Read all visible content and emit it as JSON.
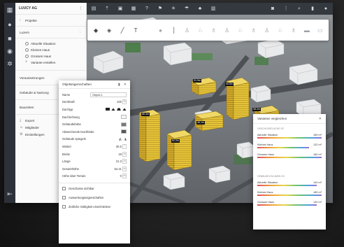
{
  "app": {
    "project_name": "LUUCY AG"
  },
  "left_panel": {
    "projects_label": "Projekte",
    "current_project": "Luzern",
    "variants": [
      "Aktuelle Situation",
      "Kleines Haus",
      "Grosses Haus"
    ],
    "add_variant": "Variante erstellen",
    "sections": [
      "Voraussetzungen",
      "Gebäude & Nutzung",
      "Bauzeiten"
    ],
    "actions": [
      "Export",
      "Mitglieder",
      "Einstellungen"
    ]
  },
  "properties_panel": {
    "title": "Objekteigenschaften",
    "name_label": "Name",
    "name_value": "Objekt 1",
    "fields": [
      {
        "label": "Deckkraft",
        "value": "100",
        "unit": "%"
      },
      {
        "label": "Dachtyp",
        "value": ""
      },
      {
        "label": "Dachrichtung",
        "value": ""
      },
      {
        "label": "Gebäudefarbe",
        "value": ""
      },
      {
        "label": "Abweichende Dachfarbe",
        "value": ""
      },
      {
        "label": "Gebäude spiegeln",
        "value": ""
      },
      {
        "label": "Winkel",
        "value": "30.5",
        "unit": "°"
      },
      {
        "label": "Breite",
        "value": "19",
        "unit": "m"
      },
      {
        "label": "Länge",
        "value": "21.3",
        "unit": "m"
      },
      {
        "label": "Gesamthöhe",
        "value": "52.21",
        "unit": "m"
      },
      {
        "label": "Höhe über Terrain",
        "value": "0",
        "unit": "m"
      }
    ],
    "checkboxes": [
      "Geschosse sichtbar",
      "Auswertungseigenschaften",
      "Zeitliche Gültigkeit einschränken"
    ]
  },
  "variants_panel": {
    "title": "Varianten vergleichen",
    "sections": [
      {
        "label": "GESCHOSSFLÄCHE GF",
        "rows": [
          {
            "name": "Aktuelle Situation",
            "value": "180 m²"
          },
          {
            "name": "Kleines Haus",
            "value": "132 m²"
          },
          {
            "name": "Grosses Haus",
            "value": "180 m²"
          }
        ]
      },
      {
        "label": "GEBÄUDEVOLUMEN GV",
        "rows": [
          {
            "name": "Aktuelle Situation",
            "value": "140 m³"
          },
          {
            "name": "Kleines Haus",
            "value": "180 m³"
          },
          {
            "name": "Grosses Haus",
            "value": "140 m³"
          }
        ]
      }
    ]
  },
  "map_labels": [
    "66.4m",
    "52.2m",
    "46.1m",
    "49.8m",
    "38.2m",
    "31.9m"
  ],
  "colors": {
    "accent_building": "#e7c93a",
    "rail": "#2c3038",
    "toolbar": "#34383f"
  }
}
